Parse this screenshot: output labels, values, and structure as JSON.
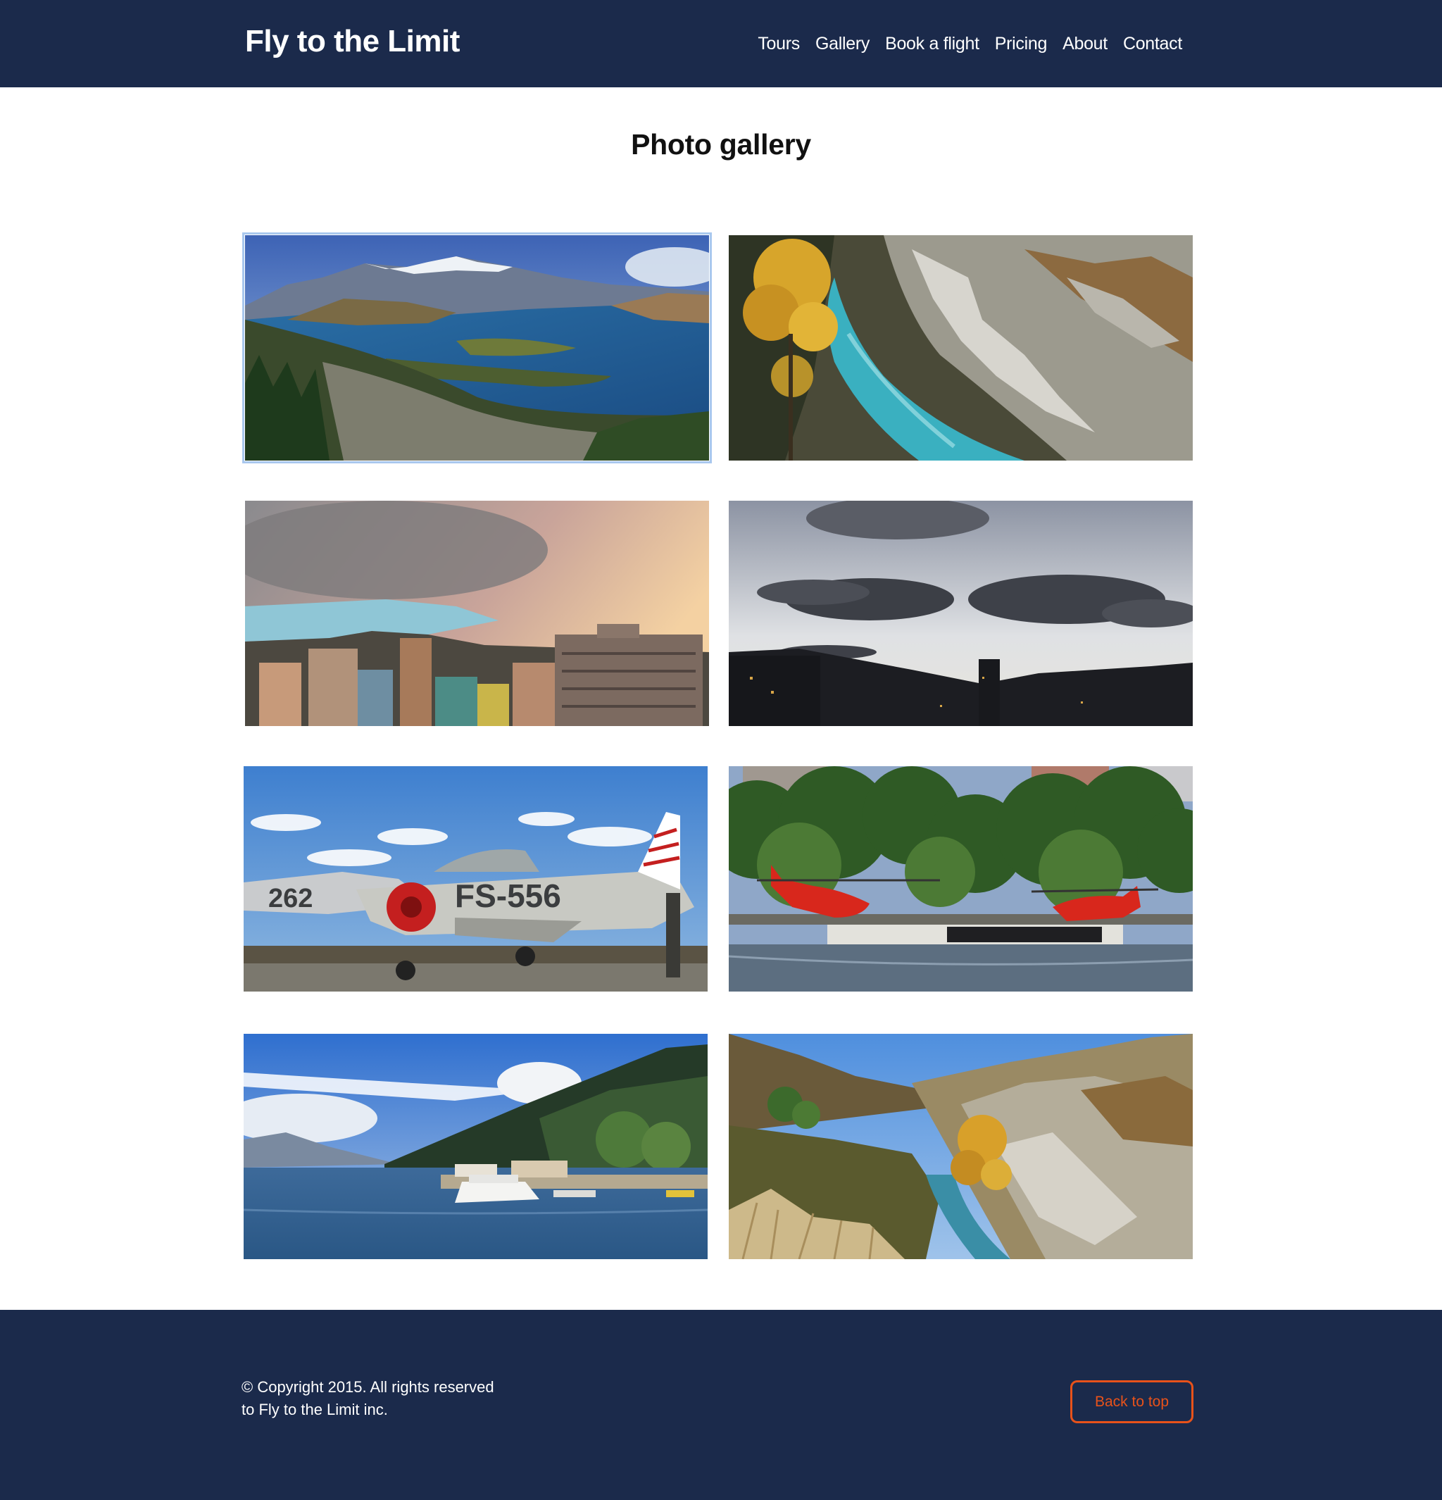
{
  "header": {
    "brand": "Fly to the Limit",
    "nav": [
      "Tours",
      "Gallery",
      "Book a flight",
      "Pricing",
      "About",
      "Contact"
    ]
  },
  "main": {
    "title": "Photo gallery",
    "photos": [
      {
        "subject": "lake and mountains panorama",
        "selected": true
      },
      {
        "subject": "river gorge with autumn tree",
        "selected": false
      },
      {
        "subject": "city skyline under pink clouds",
        "selected": false
      },
      {
        "subject": "dusk skyline silhouette",
        "selected": false
      },
      {
        "subject": "vintage jet aircraft",
        "selected": false
      },
      {
        "subject": "red helicopters on waterfront",
        "selected": false
      },
      {
        "subject": "lakeside harbor with boat",
        "selected": false
      },
      {
        "subject": "gorge valley with river",
        "selected": false
      }
    ]
  },
  "footer": {
    "copyright_line1": "© Copyright 2015. All rights reserved",
    "copyright_line2": "to Fly to the Limit inc.",
    "back_to_top": "Back to top"
  },
  "colors": {
    "header_bg": "#1b2a4b",
    "accent": "#e8521a",
    "selected_outline": "#a9c8ee"
  }
}
